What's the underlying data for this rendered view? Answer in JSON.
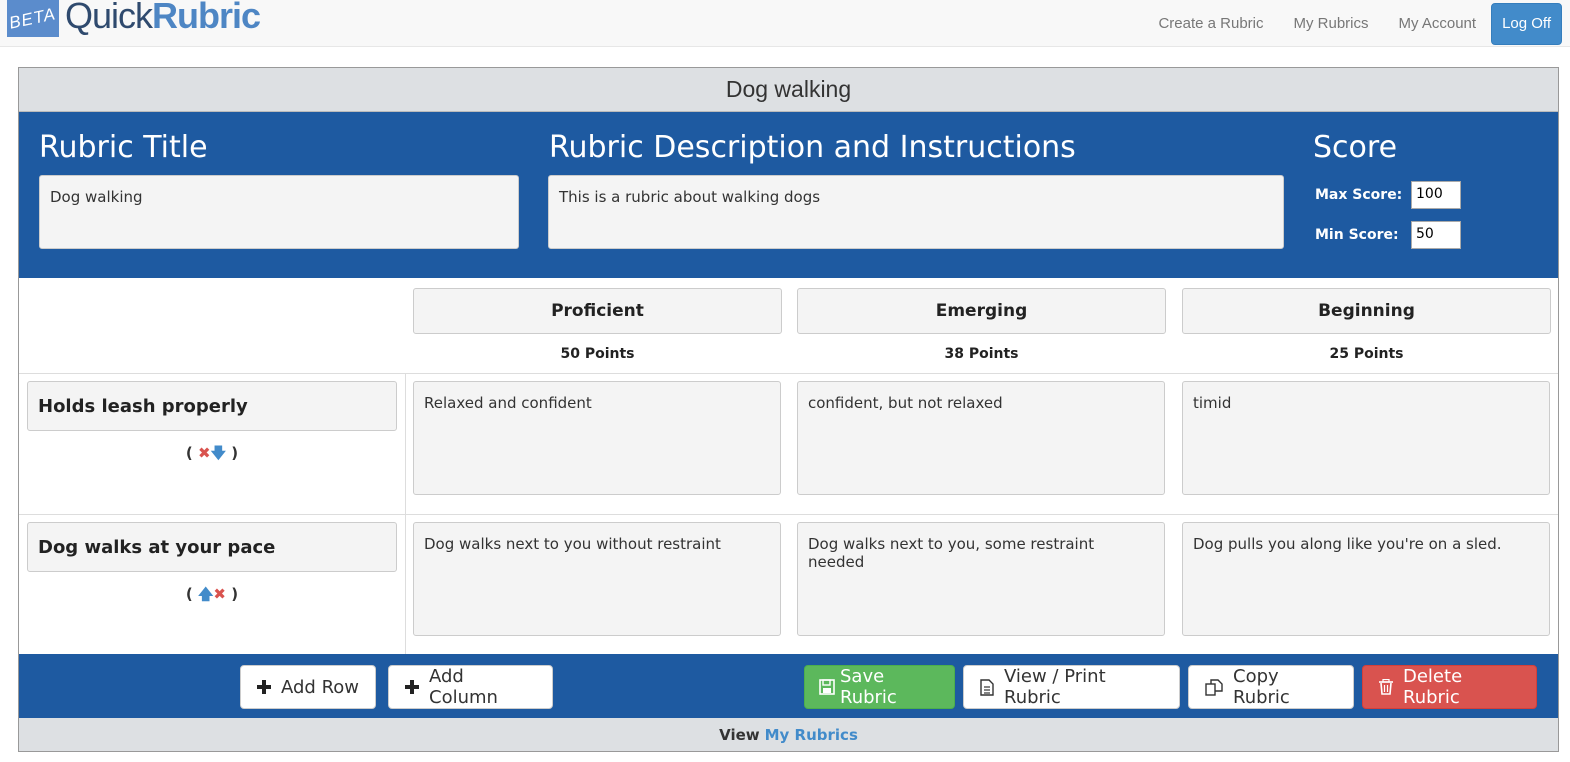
{
  "brand": {
    "badge": "BETA",
    "name_part1": "Quick",
    "name_part2": "Rubric"
  },
  "nav": {
    "links": [
      "Create a Rubric",
      "My Rubrics",
      "My Account"
    ],
    "logoff": "Log Off"
  },
  "panel": {
    "heading": "Dog walking",
    "title_section": "Rubric Title",
    "title_value": "Dog walking",
    "description_section": "Rubric Description and Instructions",
    "description_value": "This is a rubric about walking dogs",
    "score_section": "Score",
    "max_label": "Max Score:",
    "max_value": "100",
    "min_label": "Min Score:",
    "min_value": "50"
  },
  "columns": [
    {
      "name": "Proficient",
      "points": "50 Points"
    },
    {
      "name": "Emerging",
      "points": "38 Points"
    },
    {
      "name": "Beginning",
      "points": "25 Points"
    }
  ],
  "rows": [
    {
      "criterion": "Holds leash properly",
      "controls": [
        "delete",
        "move-down"
      ],
      "cells": [
        "Relaxed and confident",
        "confident, but not relaxed",
        "timid"
      ]
    },
    {
      "criterion": "Dog walks at your pace",
      "controls": [
        "move-up",
        "delete"
      ],
      "cells": [
        "Dog walks next to you without restraint",
        "Dog walks next to you, some restraint needed",
        "Dog pulls you along like you're on a sled."
      ]
    }
  ],
  "actions": {
    "add_row": "Add Row",
    "add_column": "Add Column",
    "save": "Save Rubric",
    "view_print": "View / Print Rubric",
    "copy": "Copy Rubric",
    "delete": "Delete Rubric"
  },
  "footer": {
    "prefix": "View",
    "link": "My Rubrics"
  },
  "colors": {
    "navy": "#1e5aa1",
    "accent": "#428bca",
    "success": "#5cb85c",
    "danger": "#d9534f"
  }
}
